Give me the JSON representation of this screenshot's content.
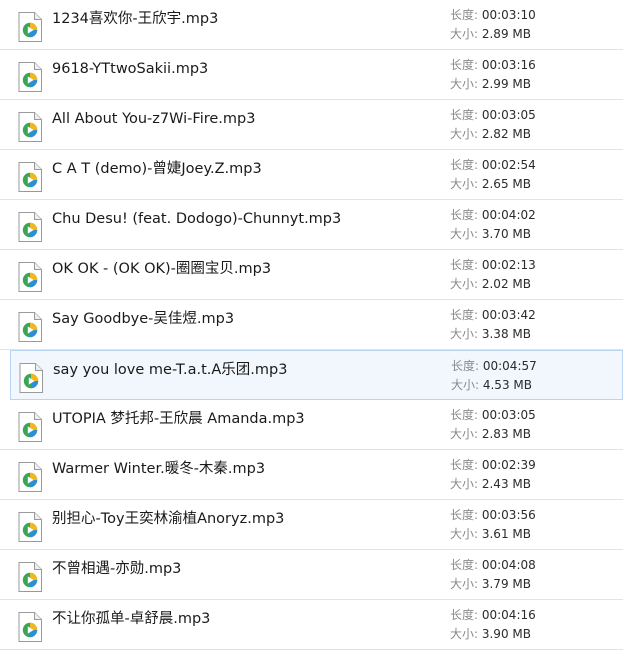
{
  "labels": {
    "duration": "长度: ",
    "size": "大小: "
  },
  "colors": {
    "selected_background": "#f2f7fd",
    "selected_border": "#b9d5f3",
    "icon_play_green": "#3aa655",
    "icon_play_blue": "#2c8fd6",
    "icon_play_yellow": "#f2b71b"
  },
  "files": [
    {
      "name": "1234喜欢你-王欣宇.mp3",
      "duration": "00:03:10",
      "size": "2.89 MB",
      "icon": "media-file-play-icon",
      "selected": false
    },
    {
      "name": "9618-YTtwoSakii.mp3",
      "duration": "00:03:16",
      "size": "2.99 MB",
      "icon": "media-file-play-icon",
      "selected": false
    },
    {
      "name": "All About You-z7Wi-Fire.mp3",
      "duration": "00:03:05",
      "size": "2.82 MB",
      "icon": "media-file-play-icon",
      "selected": false
    },
    {
      "name": "C A T (demo)-曾婕Joey.Z.mp3",
      "duration": "00:02:54",
      "size": "2.65 MB",
      "icon": "media-file-play-icon",
      "selected": false
    },
    {
      "name": "Chu Desu! (feat. Dodogo)-Chunnyt.mp3",
      "duration": "00:04:02",
      "size": "3.70 MB",
      "icon": "media-file-play-icon",
      "selected": false
    },
    {
      "name": "OK OK - (OK OK)-圈圈宝贝.mp3",
      "duration": "00:02:13",
      "size": "2.02 MB",
      "icon": "media-file-play-icon",
      "selected": false
    },
    {
      "name": "Say Goodbye-吴佳煜.mp3",
      "duration": "00:03:42",
      "size": "3.38 MB",
      "icon": "media-file-play-icon",
      "selected": false
    },
    {
      "name": "say you love me-T.a.t.A乐团.mp3",
      "duration": "00:04:57",
      "size": "4.53 MB",
      "icon": "media-file-play-icon",
      "selected": true
    },
    {
      "name": "UTOPIA 梦托邦-王欣晨 Amanda.mp3",
      "duration": "00:03:05",
      "size": "2.83 MB",
      "icon": "media-file-play-icon",
      "selected": false
    },
    {
      "name": "Warmer Winter.暖冬-木秦.mp3",
      "duration": "00:02:39",
      "size": "2.43 MB",
      "icon": "media-file-play-icon",
      "selected": false
    },
    {
      "name": "别担心-Toy王奕林渝植Anoryz.mp3",
      "duration": "00:03:56",
      "size": "3.61 MB",
      "icon": "media-file-play-icon",
      "selected": false
    },
    {
      "name": "不曾相遇-亦勋.mp3",
      "duration": "00:04:08",
      "size": "3.79 MB",
      "icon": "media-file-play-icon",
      "selected": false
    },
    {
      "name": "不让你孤单-卓舒晨.mp3",
      "duration": "00:04:16",
      "size": "3.90 MB",
      "icon": "media-file-play-icon",
      "selected": false
    }
  ]
}
